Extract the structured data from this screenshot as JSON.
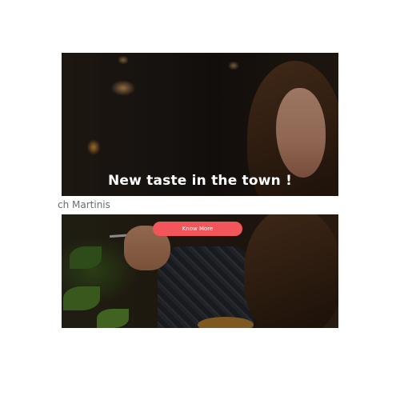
{
  "hero": {
    "title": "New taste in the town !"
  },
  "caption": {
    "text": "ch Martinis"
  },
  "cta": {
    "label": "Know More"
  },
  "colors": {
    "cta_background": "#f2555a",
    "caption_text": "#6b6b6b"
  }
}
